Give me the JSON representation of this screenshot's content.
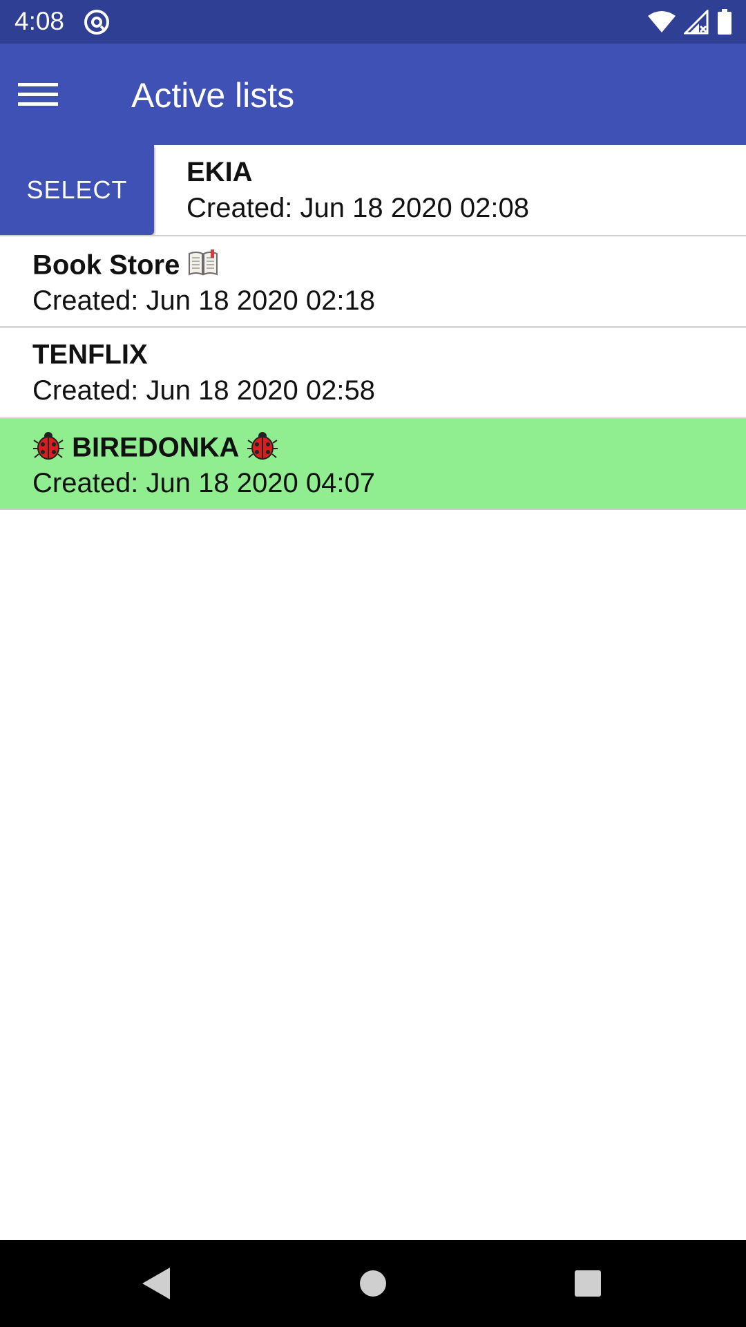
{
  "status_bar": {
    "time": "4:08",
    "icons": [
      "at-sign-icon",
      "wifi-icon",
      "signal-icon",
      "battery-icon"
    ]
  },
  "app_bar": {
    "menu_icon": "hamburger-menu-icon",
    "title": "Active lists"
  },
  "list": {
    "items": [
      {
        "title": "EKIA",
        "created": "Created: Jun 18 2020 02:08",
        "swipe_action": "SELECT",
        "highlighted": false
      },
      {
        "title": "Book Store",
        "title_suffix_icon": "open-book-icon",
        "created": "Created: Jun 18 2020 02:18",
        "highlighted": false
      },
      {
        "title": "TENFLIX",
        "created": "Created: Jun 18 2020 02:58",
        "highlighted": false
      },
      {
        "title": "BIREDONKA",
        "title_prefix_icon": "ladybug-icon",
        "title_suffix_icon": "ladybug-icon",
        "created": "Created: Jun 18 2020 04:07",
        "highlighted": true
      }
    ]
  },
  "nav_bar": {
    "icons": [
      "back-icon",
      "home-icon",
      "recents-icon"
    ]
  },
  "colors": {
    "status_bar": "#2f3f93",
    "app_bar": "#3f51b5",
    "accent": "#3f51b5",
    "highlight_row": "#90ee90"
  }
}
